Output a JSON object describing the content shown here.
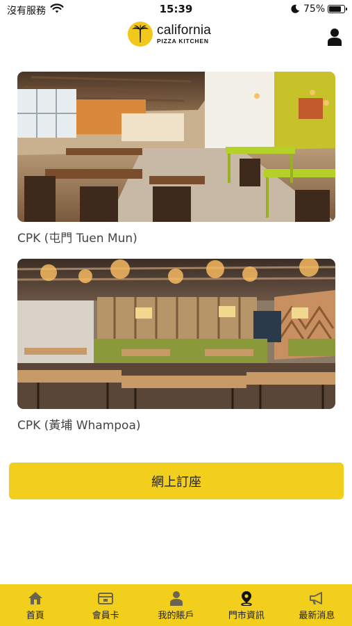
{
  "status_bar": {
    "carrier": "沒有服務",
    "time": "15:39",
    "battery": "75%"
  },
  "header": {
    "logo_line1": "california",
    "logo_line2": "PIZZA KITCHEN"
  },
  "stores": [
    {
      "name": "CPK (屯門 Tuen Mun)"
    },
    {
      "name": "CPK (黃埔 Whampoa)"
    }
  ],
  "booking_button": "網上訂座",
  "tabs": [
    {
      "label": "首頁",
      "icon": "home-icon"
    },
    {
      "label": "會員卡",
      "icon": "membership-card-icon"
    },
    {
      "label": "我的賬戶",
      "icon": "account-icon"
    },
    {
      "label": "門市資訊",
      "icon": "location-pin-icon"
    },
    {
      "label": "最新消息",
      "icon": "megaphone-icon"
    }
  ],
  "colors": {
    "brand_yellow": "#f2ce1d",
    "text_dark": "#222222"
  }
}
